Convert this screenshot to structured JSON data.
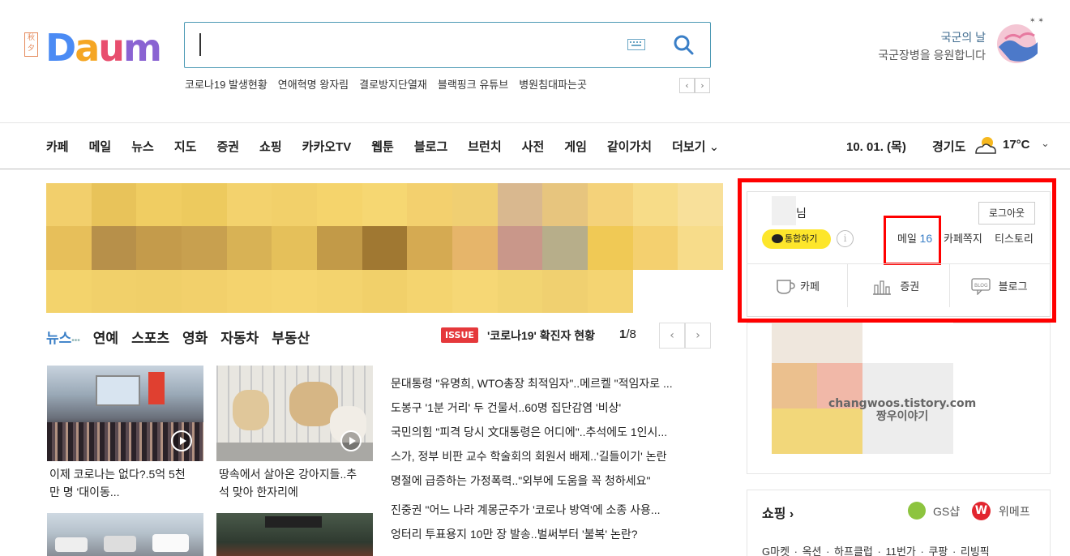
{
  "header": {
    "stamp_text": "秋夕",
    "logo": [
      "D",
      "a",
      "u",
      "m"
    ],
    "search_placeholder": "",
    "trending": [
      "코로나19 발생현황",
      "연애혁명 왕자림",
      "결로방지단열재",
      "블랙핑크 유튜브",
      "병원침대파는곳"
    ],
    "trend_prev": "‹",
    "trend_next": "›",
    "promo_line1": "국군의 날",
    "promo_line2": "국군장병을 응원합니다"
  },
  "nav": {
    "items": [
      "카페",
      "메일",
      "뉴스",
      "지도",
      "증권",
      "쇼핑",
      "카카오TV",
      "웹툰",
      "블로그",
      "브런치",
      "사전",
      "게임",
      "같이가치",
      "더보기"
    ],
    "more_chevron": "⌄",
    "date": "10. 01. (목)",
    "region": "경기도",
    "temperature": "17°C",
    "weather_chevron": "⌄"
  },
  "news": {
    "tabs": [
      "뉴스",
      "연예",
      "스포츠",
      "영화",
      "자동차",
      "부동산"
    ],
    "tab_dots": "•••",
    "issue_badge": "ISSUE",
    "issue_text": "'코로나19' 확진자 현황",
    "issue_page_current": "1",
    "issue_page_total": "/8",
    "prev": "‹",
    "next": "›",
    "thumbs": [
      {
        "caption": "이제 코로나는 없다?.5억 5천만 명 '대이동..."
      },
      {
        "caption": "땅속에서 살아온 강아지들..추석 맞아 한자리에"
      }
    ],
    "headlines_a": [
      "문대통령 \"유명희, WTO총장 최적임자\"..메르켈 \"적임자로 ...",
      "도봉구 '1분 거리' 두 건물서..60명 집단감염 '비상'",
      "국민의힘 \"피격 당시 文대통령은 어디에\"..추석에도 1인시...",
      "스가, 정부 비판 교수 학술회의 회원서 배제..'길들이기' 논란",
      "명절에 급증하는 가정폭력..\"외부에 도움을 꼭 청하세요\""
    ],
    "headlines_b": [
      "진중권 \"어느 나라 계몽군주가 '코로나 방역'에 소종 사용...",
      "엉터리 투표용지 10만 장 발송..벌써부터 '불복' 논란?"
    ]
  },
  "account": {
    "name_suffix": "님",
    "logout": "로그아웃",
    "talk_button": "통합하기",
    "info": "i",
    "mail_label": "메일",
    "mail_count": "16",
    "cafe_note": "카페쪽지",
    "tistory": "티스토리",
    "services": [
      "카페",
      "증권",
      "블로그"
    ]
  },
  "ad": {
    "watermark_line1": "changwoos.tistory.com",
    "watermark_line2": "짱우이야기"
  },
  "shopping": {
    "title": "쇼핑 ›",
    "gs_label": "GS샵",
    "wmp_label": "위메프",
    "wmp_letter": "W",
    "links": "G마켓 · 옥션 · 하프클럽 · 11번가 · 쿠팡 · 리빙픽"
  },
  "colors": {
    "accent_blue": "#3a7fc7",
    "highlight_red": "#ff0000",
    "talk_yellow": "#fde62b"
  }
}
